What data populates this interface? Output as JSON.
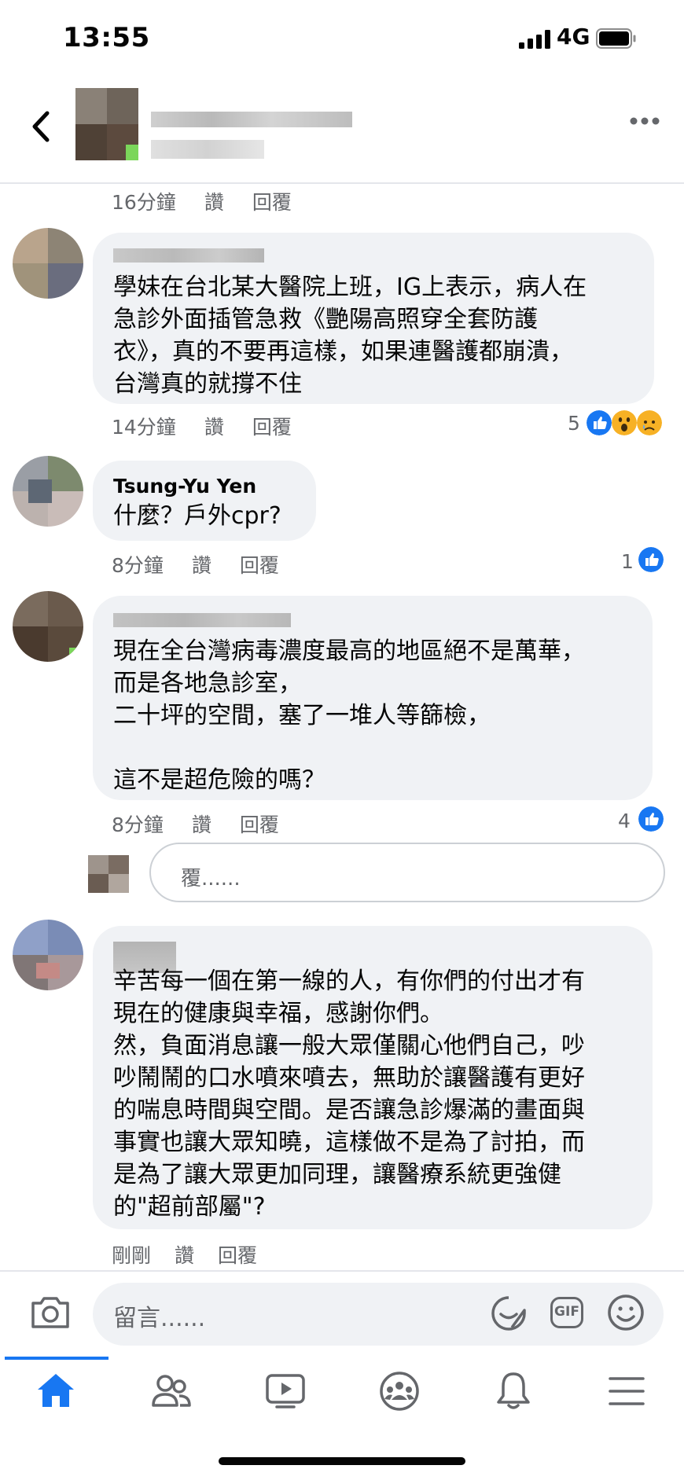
{
  "status_bar": {
    "time": "13:55",
    "network": "4G"
  },
  "header": {
    "more_icon": "more-dots-icon"
  },
  "comments": [
    {
      "time": "16分鐘",
      "like": "讚",
      "reply": "回覆"
    },
    {
      "text": "學妹在台北某大醫院上班，IG上表示，病人在\n急診外面插管急救《艷陽高照穿全套防護\n衣》，真的不要再這樣，如果連醫護都崩潰，\n台灣真的就撐不住",
      "time": "14分鐘",
      "like": "讚",
      "reply": "回覆",
      "reaction_count": "5"
    },
    {
      "name": "Tsung-Yu Yen",
      "text": "什麼？戶外cpr?",
      "time": "8分鐘",
      "like": "讚",
      "reply": "回覆",
      "reaction_count": "1"
    },
    {
      "text": "現在全台灣病毒濃度最高的地區絕不是萬華，\n而是各地急診室，\n二十坪的空間，塞了一堆人等篩檢，\n\n這不是超危險的嗎？",
      "time": "8分鐘",
      "like": "讚",
      "reply": "回覆",
      "reaction_count": "4"
    },
    {
      "text": "辛苦每一個在第一線的人，有你們的付出才有\n現在的健康與幸福，感謝你們。\n然，負面消息讓一般大眾僅關心他們自己，吵\n吵鬧鬧的口水噴來噴去，無助於讓醫護有更好\n的喘息時間與空間。是否讓急診爆滿的畫面與\n事實也讓大眾知曉，這樣做不是為了討拍，而\n是為了讓大眾更加同理，讓醫療系統更強健\n的\"超前部屬\"?",
      "time": "剛剛",
      "like": "讚",
      "reply": "回覆"
    }
  ],
  "reply_box": {
    "placeholder": "覆......"
  },
  "composer": {
    "placeholder": "留言......",
    "gif_label": "GIF"
  },
  "colors": {
    "accent": "#1877f2",
    "bubble": "#f0f2f5",
    "meta_text": "#65676b"
  }
}
